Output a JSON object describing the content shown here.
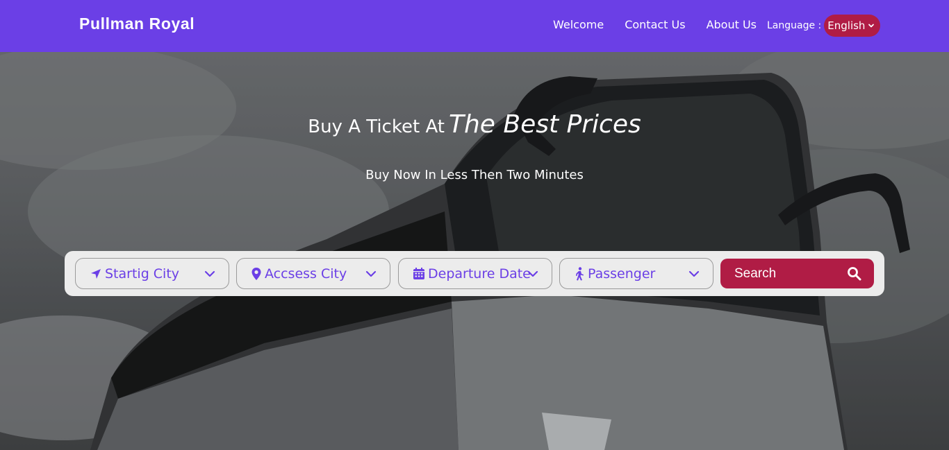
{
  "header": {
    "brand": "Pullman Royal",
    "nav": [
      "Welcome",
      "Contact Us",
      "About Us"
    ],
    "language_label": "Language :",
    "language_value": "English"
  },
  "hero": {
    "headline_part1": "Buy A Ticket At",
    "headline_part2": "The Best Prices",
    "subheadline": "Buy Now In Less Then Two Minutes"
  },
  "search": {
    "starting_city": "Startig City",
    "access_city": "Accsess City",
    "departure_date": "Departure Date",
    "passenger": "Passenger",
    "search_label": "Search"
  },
  "icons": {
    "starting_city": "location-arrow-icon",
    "access_city": "map-marker-icon",
    "departure_date": "calendar-icon",
    "passenger": "walking-person-icon",
    "dropdown": "chevron-down-icon",
    "search": "search-icon"
  },
  "colors": {
    "header_bg": "#6b3fe6",
    "accent": "#b01c45",
    "field_text": "#6b3fe6"
  }
}
